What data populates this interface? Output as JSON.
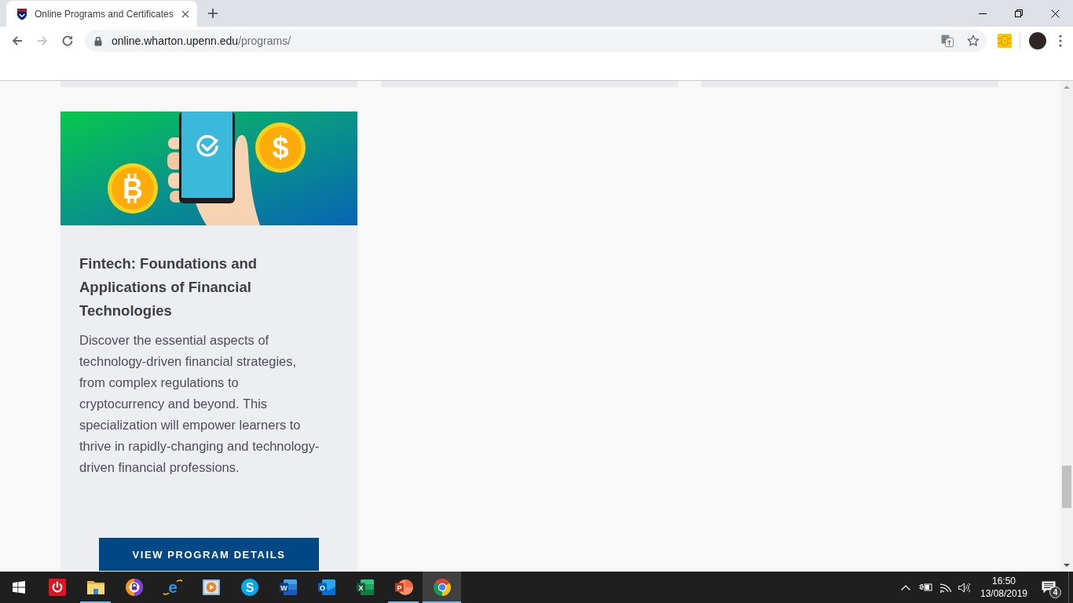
{
  "browser": {
    "tabs": [
      {
        "title": "Online Programs and Certificates",
        "selected": true
      }
    ],
    "nav_buttons": [
      {
        "kind": "back",
        "disabled": false
      },
      {
        "kind": "forward",
        "disabled": true
      },
      {
        "kind": "reload",
        "disabled": false
      }
    ],
    "address": {
      "host": "online.wharton.upenn.edu",
      "path": "/programs/"
    }
  },
  "page": {
    "program_card": {
      "coin_symbols": [
        "B",
        "$"
      ],
      "title": "Fintech: Foundations and Applications of Financial Technologies",
      "description": "Discover the essential aspects of technology-driven financial strategies, from complex regulations to cryptocurrency and beyond. This specialization will empower learners to thrive in rapidly-changing and technology-driven financial professions.",
      "button": "VIEW PROGRAM DETAILS"
    }
  },
  "taskbar": {
    "apps": [
      {
        "kind": "power",
        "running": false,
        "selected": false
      },
      {
        "kind": "explorer",
        "running": true,
        "selected": false
      },
      {
        "kind": "secure-browser",
        "running": false,
        "selected": false
      },
      {
        "kind": "ie",
        "glyph": "e",
        "running": false,
        "selected": false
      },
      {
        "kind": "media",
        "running": false,
        "selected": false
      },
      {
        "kind": "skype",
        "glyph": "S",
        "running": false,
        "selected": false
      },
      {
        "kind": "word",
        "glyph": "W",
        "running": false,
        "selected": false
      },
      {
        "kind": "outlook",
        "glyph": "O",
        "running": false,
        "selected": false
      },
      {
        "kind": "excel",
        "glyph": "X",
        "running": false,
        "selected": false
      },
      {
        "kind": "powerpoint",
        "glyph": "P",
        "running": true,
        "selected": false
      },
      {
        "kind": "chrome",
        "running": true,
        "selected": true
      }
    ],
    "clock": {
      "time": "16:50",
      "date": "13/08/2019"
    },
    "notifications": {
      "count": "4"
    }
  }
}
